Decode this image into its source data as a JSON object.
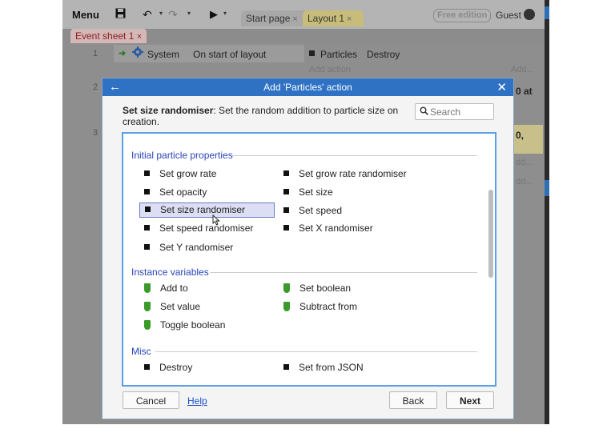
{
  "toolbar": {
    "menu_label": "Menu",
    "tabs": [
      {
        "label": "Start page",
        "close": "×"
      },
      {
        "label": "Layout 1",
        "close": "×"
      }
    ],
    "free_edition": "Free edition",
    "user": "Guest"
  },
  "event_sheet": {
    "tab_label": "Event sheet 1",
    "tab_close": "×",
    "rows": [
      {
        "num": "1",
        "object": "System",
        "condition": "On start of layout",
        "action_object": "Particles",
        "action": "Destroy",
        "add_action": "Add action",
        "add_right": "Add..."
      },
      {
        "num": "2",
        "right_fragment": "0 at"
      },
      {
        "num": "3",
        "right_fragment": "0,"
      }
    ],
    "add_fragments": [
      "dd...",
      "dd..."
    ]
  },
  "dialog": {
    "title": "Add 'Particles' action",
    "description_bold": "Set size randomiser",
    "description_rest": ": Set the random addition to particle size on creation.",
    "search_placeholder": "Search",
    "sections": [
      {
        "heading": "Initial particle properties",
        "items": [
          "Set grow rate",
          "Set grow rate randomiser",
          "Set opacity",
          "Set size",
          "Set size randomiser",
          "Set speed",
          "Set speed randomiser",
          "Set X randomiser",
          "Set Y randomiser"
        ],
        "selected": "Set size randomiser"
      },
      {
        "heading": "Instance variables",
        "items": [
          "Add to",
          "Set boolean",
          "Set value",
          "Subtract from",
          "Toggle boolean"
        ]
      },
      {
        "heading": "Misc",
        "items": [
          "Destroy",
          "Set from JSON"
        ]
      }
    ],
    "buttons": {
      "cancel": "Cancel",
      "help": "Help",
      "back": "Back",
      "next": "Next"
    }
  },
  "colors": {
    "accent": "#2f72c4",
    "section_heading": "#2a45b8",
    "instance_var_icon": "#3a9a2a",
    "selection_bg": "#dcdff4"
  }
}
